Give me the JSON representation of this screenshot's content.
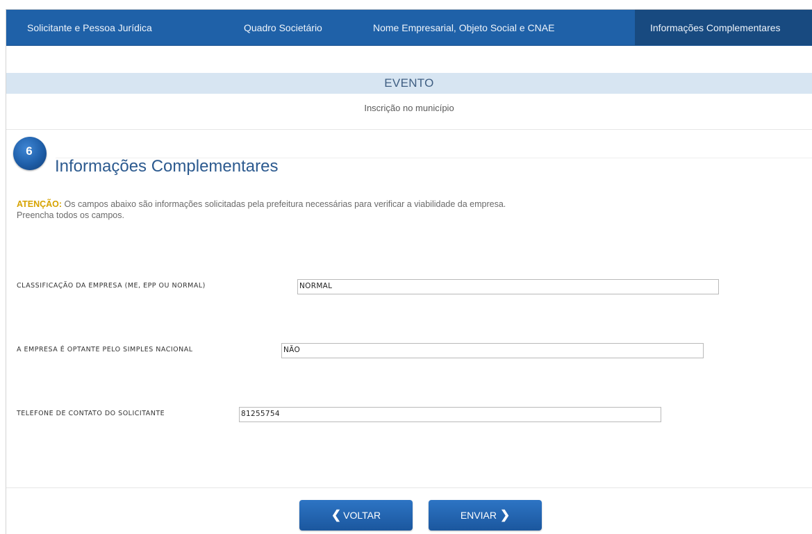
{
  "tabs": [
    {
      "label": "Solicitante e Pessoa Jurídica"
    },
    {
      "label": "Quadro Societário"
    },
    {
      "label": "Nome Empresarial, Objeto Social e CNAE"
    },
    {
      "label": "Informações Complementares"
    }
  ],
  "evento": {
    "title": "EVENTO",
    "description": "Inscrição no município"
  },
  "section": {
    "step": "6",
    "title": "Informações Complementares"
  },
  "notice": {
    "warn": "ATENÇÃO:",
    "text": " Os campos abaixo são informações solicitadas pela prefeitura necessárias para verificar a viabilidade da empresa.",
    "text2": "Preencha todos os campos."
  },
  "fields": [
    {
      "label": "CLASSIFICAÇÃO DA EMPRESA (ME, EPP OU NORMAL)",
      "value": "NORMAL"
    },
    {
      "label": "A EMPRESA É OPTANTE PELO SIMPLES NACIONAL",
      "value": "NÃO"
    },
    {
      "label": "TELEFONE DE CONTATO DO SOLICITANTE",
      "value": "81255754"
    }
  ],
  "buttons": {
    "back_label": "VOLTAR",
    "back_icon": "chevron-left-icon",
    "send_label": "ENVIAR",
    "send_icon": "chevron-right-icon"
  },
  "colors": {
    "nav_bg": "#1f61a8",
    "nav_active": "#184a80",
    "evento_bg": "#d7e5f2",
    "title_color": "#2c5a8f",
    "warning": "#d6a300",
    "button_bg": "#1b579e"
  }
}
